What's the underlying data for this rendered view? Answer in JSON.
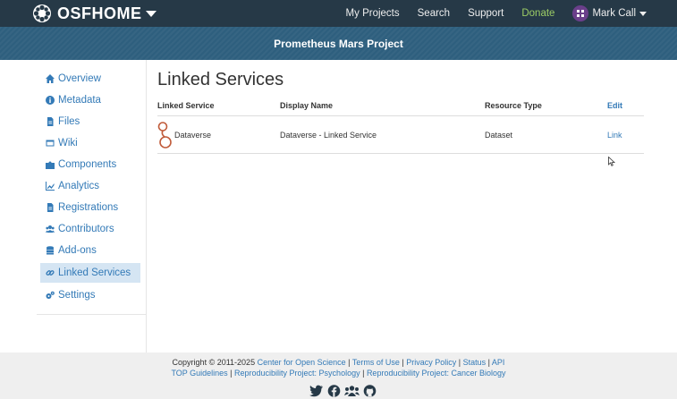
{
  "navbar": {
    "brand": "OSFHOME",
    "links": [
      "My Projects",
      "Search",
      "Support",
      "Donate"
    ],
    "user": "Mark Call"
  },
  "project": {
    "title": "Prometheus Mars Project"
  },
  "sidebar": {
    "items": [
      {
        "label": "Overview",
        "icon": "home-icon"
      },
      {
        "label": "Metadata",
        "icon": "info-icon"
      },
      {
        "label": "Files",
        "icon": "file-icon"
      },
      {
        "label": "Wiki",
        "icon": "wiki-icon"
      },
      {
        "label": "Components",
        "icon": "puzzle-icon"
      },
      {
        "label": "Analytics",
        "icon": "chart-icon"
      },
      {
        "label": "Registrations",
        "icon": "registration-icon"
      },
      {
        "label": "Contributors",
        "icon": "users-icon"
      },
      {
        "label": "Add-ons",
        "icon": "database-icon"
      },
      {
        "label": "Linked Services",
        "icon": "link-icon"
      },
      {
        "label": "Settings",
        "icon": "gears-icon"
      }
    ],
    "active": "Linked Services"
  },
  "main": {
    "title": "Linked Services",
    "table": {
      "headers": [
        "Linked Service",
        "Display Name",
        "Resource Type",
        "Edit"
      ],
      "rows": [
        {
          "service": "Dataverse",
          "display_name": "Dataverse - Linked Service",
          "resource_type": "Dataset",
          "action": "Link"
        }
      ]
    }
  },
  "footer": {
    "copyright": "Copyright © 2011-2025",
    "links1": [
      "Center for Open Science",
      "Terms of Use",
      "Privacy Policy",
      "Status",
      "API"
    ],
    "links2": [
      "TOP Guidelines",
      "Reproducibility Project: Psychology",
      "Reproducibility Project: Cancer Biology"
    ],
    "social_icons": [
      "twitter-icon",
      "facebook-icon",
      "group-icon",
      "github-icon"
    ]
  }
}
